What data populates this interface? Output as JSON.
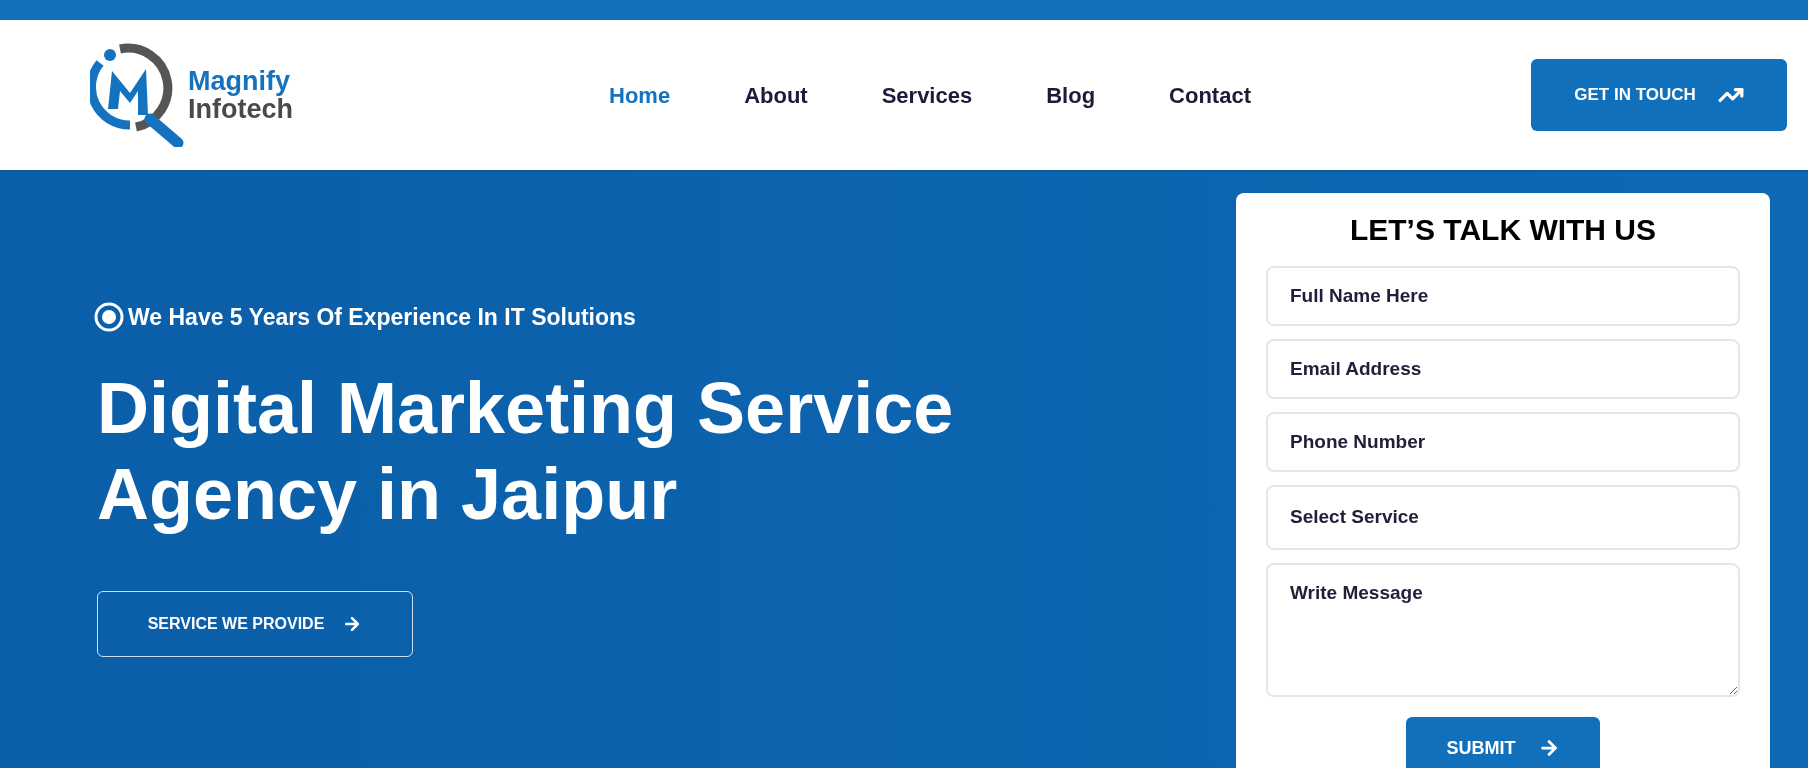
{
  "logo": {
    "line_1": "Magnify",
    "line_2": "Infotech"
  },
  "nav": [
    {
      "label": "Home",
      "selected": true
    },
    {
      "label": "About",
      "selected": false
    },
    {
      "label": "Services",
      "selected": false
    },
    {
      "label": "Blog",
      "selected": false
    },
    {
      "label": "Contact",
      "selected": false
    }
  ],
  "header_button": "GET IN TOUCH",
  "hero": {
    "badge": "We Have 5 Years Of Experience In IT Solutions",
    "heading_lines": [
      "Digital Marketing Service",
      "Agency in Jaipur"
    ],
    "button": "SERVICE WE PROVIDE"
  },
  "form": {
    "title": "LET’S TALK WITH US",
    "fields": [
      {
        "kind": "input",
        "placeholder": "Full Name Here"
      },
      {
        "kind": "input",
        "placeholder": "Email Address"
      },
      {
        "kind": "input",
        "placeholder": "Phone Number"
      },
      {
        "kind": "select",
        "placeholder": "Select Service"
      },
      {
        "kind": "textarea",
        "placeholder": "Write Message"
      }
    ],
    "submit": "SUBMIT"
  }
}
